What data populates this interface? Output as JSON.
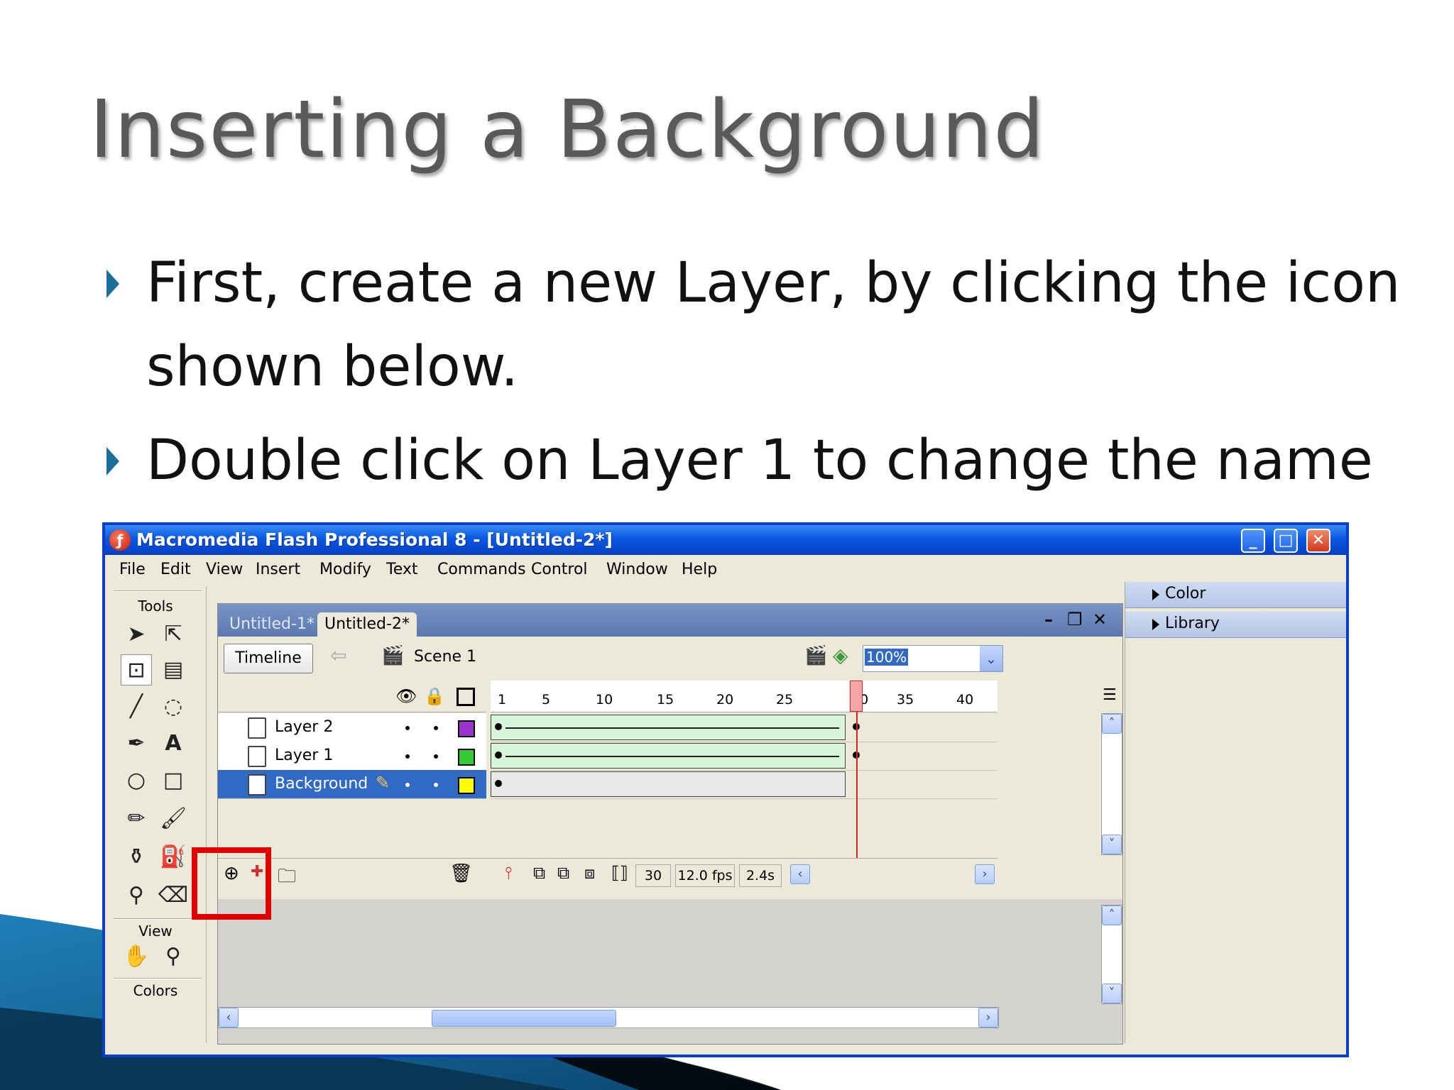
{
  "slide": {
    "title": "Inserting a Background",
    "bullets": [
      "First, create a new Layer, by clicking the icon",
      "shown below.",
      "Double click on Layer 1 to change the name"
    ]
  },
  "window": {
    "title": "Macromedia Flash Professional 8 - [Untitled-2*]",
    "controls": {
      "minimize": "_",
      "maximize": "□",
      "close": "✕"
    }
  },
  "menu": [
    "File",
    "Edit",
    "View",
    "Insert",
    "Modify",
    "Text",
    "Commands",
    "Control",
    "Window",
    "Help"
  ],
  "tools": {
    "title": "Tools",
    "view_label": "View",
    "colors_label": "Colors"
  },
  "document": {
    "tabs": [
      "Untitled-1*",
      "Untitled-2*"
    ],
    "active_tab": "Untitled-2*",
    "timeline_button": "Timeline",
    "scene": "Scene 1",
    "zoom": "100%"
  },
  "timeline": {
    "frame_numbers": [
      "1",
      "5",
      "10",
      "15",
      "20",
      "25",
      "30",
      "35",
      "40"
    ],
    "layers": [
      {
        "name": "Layer 2",
        "color": "#9933cc",
        "selected": false
      },
      {
        "name": "Layer 1",
        "color": "#33cc33",
        "selected": false
      },
      {
        "name": "Background",
        "color": "#ffff00",
        "selected": true
      }
    ],
    "current_frame": "30",
    "frame_rate": "12.0 fps",
    "elapsed": "2.4s"
  },
  "panels": [
    "Color",
    "Library"
  ],
  "colors": {
    "highlight": "#e00000",
    "titlebar": "#0a58e0",
    "accent": "#1d6e9c"
  }
}
